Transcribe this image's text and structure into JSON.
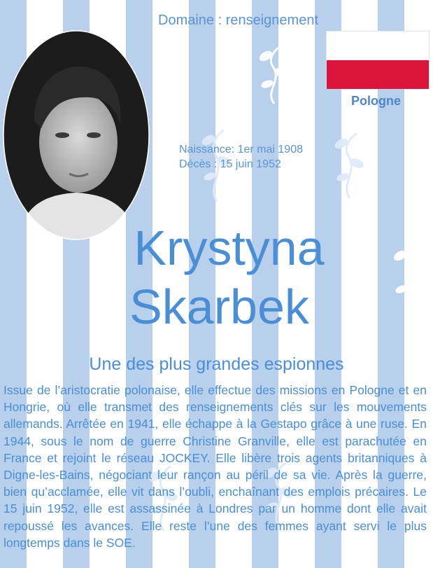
{
  "domain_label": "Domaine : renseignement",
  "country": "Pologne",
  "flag": {
    "top": "#ffffff",
    "bottom": "#dc143c"
  },
  "birth": "Naissance: 1er mai 1908",
  "death": "Décès : 15 juin 1952",
  "first_name": "Krystyna",
  "last_name": "Skarbek",
  "subtitle": "Une des plus grandes espionnes",
  "bio": "Issue de l’aristocratie polonaise, elle effectue des missions en Pologne et en Hongrie, où elle transmet des renseignements clés sur les mouvements allemands. Arrêtée en 1941, elle échappe à la Gestapo grâce à une ruse. En 1944, sous le nom de guerre Christine Granville, elle est parachutée en France et rejoint le réseau JOCKEY. Elle libère trois agents britanniques à Digne-les-Bains, négociant leur rançon au péril de sa vie. Après la guerre, bien qu’acclamée, elle vit dans l’oubli, enchaînant des emplois précaires. Le 15 juin 1952, elle est assassinée à Londres par un homme dont elle avait repoussé les avances. Elle reste l’une des femmes ayant servi le plus longtemps dans le SOE.",
  "colors": {
    "accent": "#4a8fd6",
    "stripe": "#b8d0ec"
  },
  "icons": [
    "leaf-ornament-icon"
  ]
}
